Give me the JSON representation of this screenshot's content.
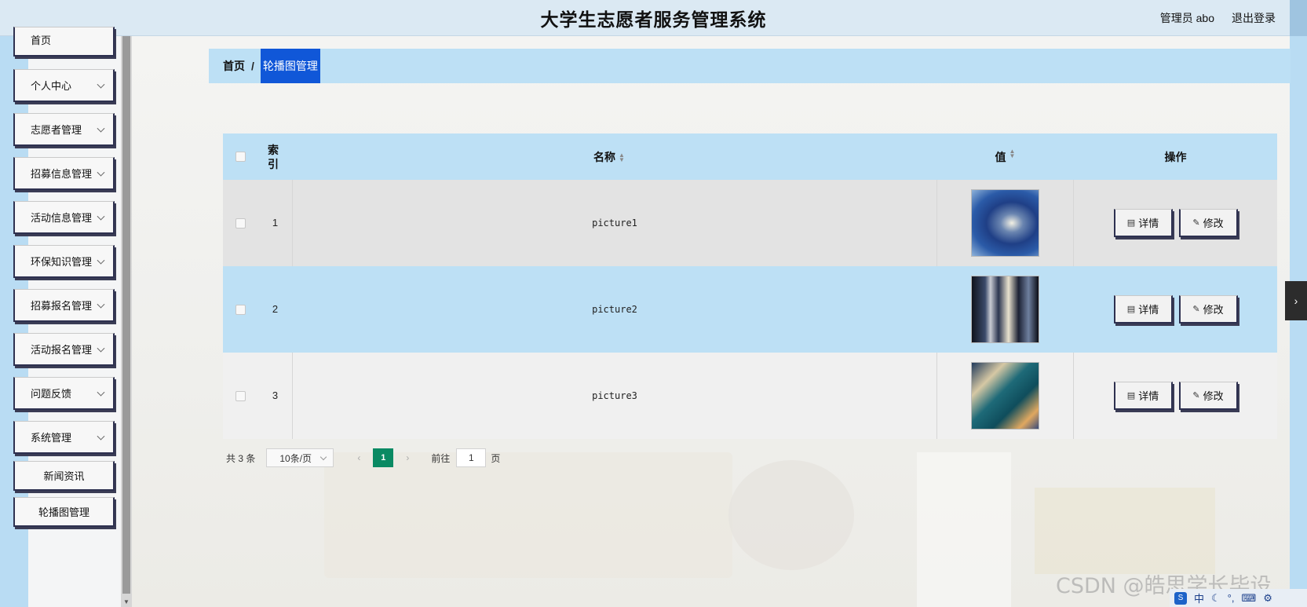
{
  "header": {
    "title": "大学生志愿者服务管理系统",
    "user_label": "管理员 abo",
    "logout_label": "退出登录"
  },
  "sidebar": {
    "items": [
      {
        "label": "首页",
        "expandable": false
      },
      {
        "label": "个人中心",
        "expandable": true
      },
      {
        "label": "志愿者管理",
        "expandable": true
      },
      {
        "label": "招募信息管理",
        "expandable": true
      },
      {
        "label": "活动信息管理",
        "expandable": true
      },
      {
        "label": "环保知识管理",
        "expandable": true
      },
      {
        "label": "招募报名管理",
        "expandable": true
      },
      {
        "label": "活动报名管理",
        "expandable": true
      },
      {
        "label": "问题反馈",
        "expandable": true
      },
      {
        "label": "系统管理",
        "expandable": true
      },
      {
        "label": "新闻资讯",
        "expandable": false
      },
      {
        "label": "轮播图管理",
        "expandable": false
      }
    ]
  },
  "breadcrumb": {
    "home": "首页",
    "separator": "/",
    "current": "轮播图管理"
  },
  "table": {
    "columns": {
      "index": "索引",
      "name": "名称",
      "value": "值",
      "actions": "操作"
    },
    "rows": [
      {
        "index": "1",
        "name": "picture1",
        "image": "abstract blue tunnel"
      },
      {
        "index": "2",
        "name": "picture2",
        "image": "dark architecture"
      },
      {
        "index": "3",
        "name": "picture3",
        "image": "teal interior"
      }
    ],
    "detail_label": "详情",
    "edit_label": "修改"
  },
  "pagination": {
    "total": "共 3 条",
    "page_size": "10条/页",
    "current_page": "1",
    "goto_label": "前往",
    "goto_value": "1",
    "page_suffix": "页"
  },
  "watermark": "CSDN @皓思学长毕设",
  "tray": {
    "ime": "中"
  },
  "colors": {
    "header_bg": "#dbe9f3",
    "breadcrumb_bg": "#bde0f5",
    "active_crumb": "#1057d8",
    "page_active": "#0a8a63"
  }
}
